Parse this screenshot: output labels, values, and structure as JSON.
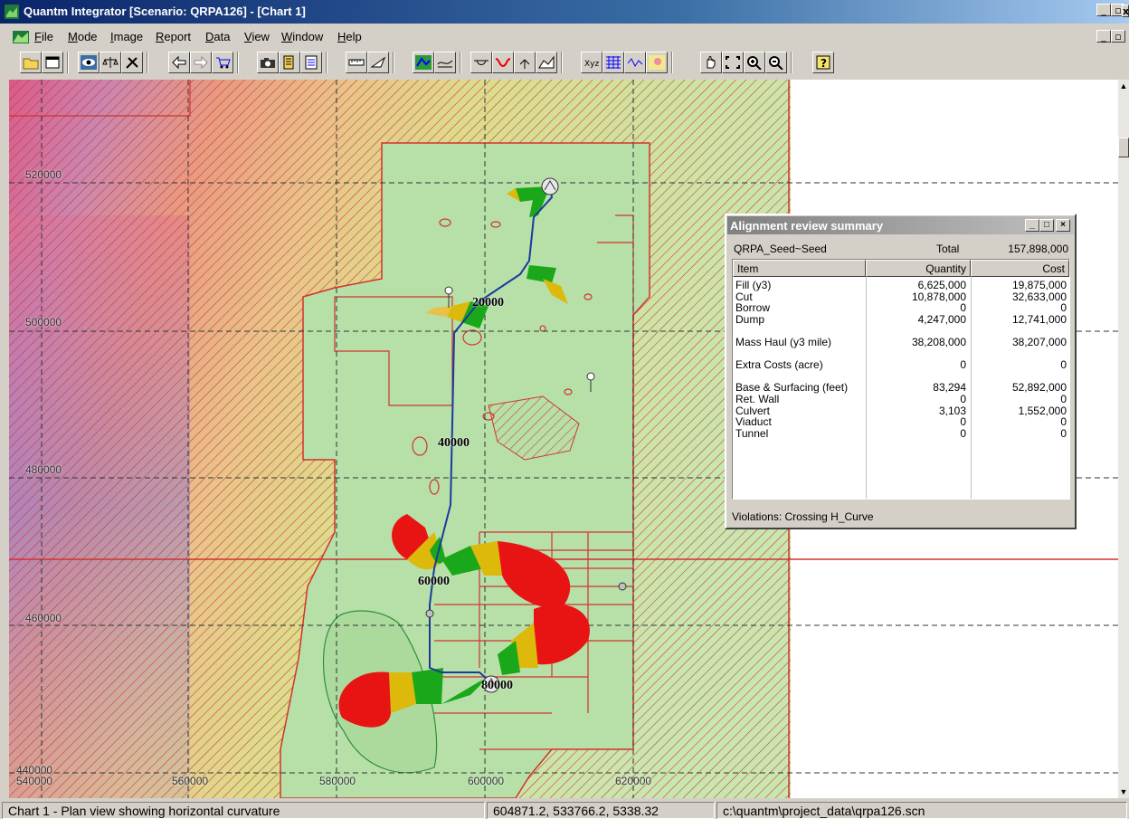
{
  "window": {
    "title": "Quantm Integrator [Scenario: QRPA126] - [Chart 1]"
  },
  "menu": [
    {
      "label": "File",
      "ul": "F",
      "rest": "ile"
    },
    {
      "label": "Mode",
      "ul": "M",
      "rest": "ode"
    },
    {
      "label": "Image",
      "ul": "I",
      "rest": "mage"
    },
    {
      "label": "Report",
      "ul": "R",
      "rest": "eport"
    },
    {
      "label": "Data",
      "ul": "D",
      "rest": "ata"
    },
    {
      "label": "View",
      "ul": "V",
      "rest": "iew"
    },
    {
      "label": "Window",
      "ul": "W",
      "rest": "indow"
    },
    {
      "label": "Help",
      "ul": "H",
      "rest": "elp"
    }
  ],
  "chart": {
    "y_labels": [
      "520000",
      "500000",
      "480000",
      "460000",
      "440000"
    ],
    "x_labels": [
      "540000",
      "560000",
      "580000",
      "600000",
      "620000"
    ],
    "station_labels": [
      "20000",
      "40000",
      "60000",
      "80000"
    ]
  },
  "summary": {
    "title": "Alignment review summary",
    "scenario": "QRPA_Seed~Seed",
    "total_label": "Total",
    "total_value": "157,898,000",
    "columns": [
      "Item",
      "Quantity",
      "Cost"
    ],
    "rows": [
      {
        "item": "Fill (y3)",
        "quantity": "6,625,000",
        "cost": "19,875,000"
      },
      {
        "item": "Cut",
        "quantity": "10,878,000",
        "cost": "32,633,000"
      },
      {
        "item": "Borrow",
        "quantity": "0",
        "cost": "0"
      },
      {
        "item": "Dump",
        "quantity": "4,247,000",
        "cost": "12,741,000"
      },
      {
        "item": "",
        "quantity": "",
        "cost": ""
      },
      {
        "item": "Mass Haul (y3 mile)",
        "quantity": "38,208,000",
        "cost": "38,207,000"
      },
      {
        "item": "",
        "quantity": "",
        "cost": ""
      },
      {
        "item": "Extra Costs (acre)",
        "quantity": "0",
        "cost": "0"
      },
      {
        "item": "",
        "quantity": "",
        "cost": ""
      },
      {
        "item": "Base & Surfacing (feet)",
        "quantity": "83,294",
        "cost": "52,892,000"
      },
      {
        "item": "Ret. Wall",
        "quantity": "0",
        "cost": "0"
      },
      {
        "item": "Culvert",
        "quantity": "3,103",
        "cost": "1,552,000"
      },
      {
        "item": "Viaduct",
        "quantity": "0",
        "cost": "0"
      },
      {
        "item": "Tunnel",
        "quantity": "0",
        "cost": "0"
      }
    ],
    "violations": "Violations:  Crossing H_Curve"
  },
  "status": {
    "description": "Chart 1 - Plan view showing horizontal curvature",
    "coords": "604871.2, 533766.2, 5338.32",
    "file": "c:\\quantm\\project_data\\qrpa126.scn"
  }
}
